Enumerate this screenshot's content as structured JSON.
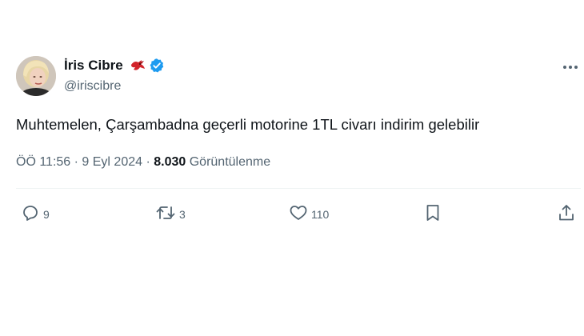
{
  "user": {
    "display_name": "İris Cibre",
    "handle": "@iriscibre"
  },
  "icons": {
    "bird": "red-bird-emoji-icon",
    "verified": "verified-badge-icon",
    "more": "more-options-icon",
    "reply": "reply-icon",
    "retweet": "retweet-icon",
    "like": "like-heart-icon",
    "bookmark": "bookmark-icon",
    "share": "share-icon"
  },
  "colors": {
    "verified_blue": "#1d9bf0",
    "bird_red": "#d2232a",
    "secondary_text": "#536471",
    "primary_text": "#0f1419"
  },
  "tweet": {
    "text": "Muhtemelen, Çarşambadna geçerli motorine 1TL civarı indirim gelebilir",
    "time": "ÖÖ 11:56",
    "separator1": " · ",
    "date": "9 Eyl 2024",
    "separator2": " · ",
    "views_count": "8.030",
    "views_label": " Görüntülenme"
  },
  "actions": {
    "replies": "9",
    "retweets": "3",
    "likes": "110"
  }
}
